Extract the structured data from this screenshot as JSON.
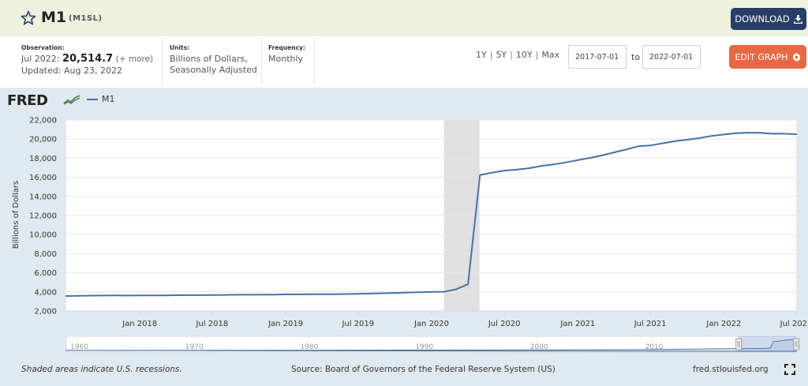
{
  "header": {
    "title": "M1",
    "series_id": "(M1SL)",
    "download_label": "DOWNLOAD"
  },
  "meta": {
    "observation_label": "Observation:",
    "observation_date": "Jul 2022:",
    "observation_value": "20,514.7",
    "observation_more": "(+ more)",
    "updated": "Updated: Aug 23, 2022",
    "units_label": "Units:",
    "units_line1": "Billions of Dollars,",
    "units_line2": "Seasonally Adjusted",
    "frequency_label": "Frequency:",
    "frequency_value": "Monthly"
  },
  "controls": {
    "ranges": [
      "1Y",
      "5Y",
      "10Y",
      "Max"
    ],
    "start_date": "2017-07-01",
    "to_label": "to",
    "end_date": "2022-07-01",
    "edit_label": "EDIT GRAPH"
  },
  "colors": {
    "series": "#4572a7",
    "download": "#283e66",
    "edit": "#e46a43",
    "recession": "#e0e0e0"
  },
  "chart_header": {
    "logo": "FRED",
    "legend_label": "M1"
  },
  "chart_data": {
    "type": "line",
    "title": "",
    "ylabel": "Billions of Dollars",
    "xlabel": "",
    "ylim": [
      2000,
      22000
    ],
    "xlim": [
      "2017-07-01",
      "2022-07-01"
    ],
    "grid": "horizontal",
    "legend_position": "top-left",
    "yticks": [
      2000,
      4000,
      6000,
      8000,
      10000,
      12000,
      14000,
      16000,
      18000,
      20000,
      22000
    ],
    "ytick_labels": [
      "2,000",
      "4,000",
      "6,000",
      "8,000",
      "10,000",
      "12,000",
      "14,000",
      "16,000",
      "18,000",
      "20,000",
      "22,000"
    ],
    "xticks": [
      {
        "date": "2018-01-01",
        "label": "Jan 2018"
      },
      {
        "date": "2018-07-01",
        "label": "Jul 2018"
      },
      {
        "date": "2019-01-01",
        "label": "Jan 2019"
      },
      {
        "date": "2019-07-01",
        "label": "Jul 2019"
      },
      {
        "date": "2020-01-01",
        "label": "Jan 2020"
      },
      {
        "date": "2020-07-01",
        "label": "Jul 2020"
      },
      {
        "date": "2021-01-01",
        "label": "Jan 2021"
      },
      {
        "date": "2021-07-01",
        "label": "Jul 2021"
      },
      {
        "date": "2022-01-01",
        "label": "Jan 2022"
      },
      {
        "date": "2022-07-01",
        "label": "Jul 2022"
      }
    ],
    "recessions": [
      {
        "start": "2020-02-01",
        "end": "2020-04-30"
      }
    ],
    "series": [
      {
        "name": "M1",
        "points": [
          [
            "2017-07-01",
            3570
          ],
          [
            "2017-08-01",
            3590
          ],
          [
            "2017-09-01",
            3610
          ],
          [
            "2017-10-01",
            3620
          ],
          [
            "2017-11-01",
            3630
          ],
          [
            "2017-12-01",
            3620
          ],
          [
            "2018-01-01",
            3640
          ],
          [
            "2018-02-01",
            3630
          ],
          [
            "2018-03-01",
            3640
          ],
          [
            "2018-04-01",
            3650
          ],
          [
            "2018-05-01",
            3660
          ],
          [
            "2018-06-01",
            3660
          ],
          [
            "2018-07-01",
            3680
          ],
          [
            "2018-08-01",
            3690
          ],
          [
            "2018-09-01",
            3700
          ],
          [
            "2018-10-01",
            3700
          ],
          [
            "2018-11-01",
            3710
          ],
          [
            "2018-12-01",
            3720
          ],
          [
            "2019-01-01",
            3740
          ],
          [
            "2019-02-01",
            3740
          ],
          [
            "2019-03-01",
            3750
          ],
          [
            "2019-04-01",
            3750
          ],
          [
            "2019-05-01",
            3760
          ],
          [
            "2019-06-01",
            3780
          ],
          [
            "2019-07-01",
            3800
          ],
          [
            "2019-08-01",
            3830
          ],
          [
            "2019-09-01",
            3860
          ],
          [
            "2019-10-01",
            3890
          ],
          [
            "2019-11-01",
            3930
          ],
          [
            "2019-12-01",
            3970
          ],
          [
            "2020-01-01",
            4000
          ],
          [
            "2020-02-01",
            4020
          ],
          [
            "2020-03-01",
            4260
          ],
          [
            "2020-04-01",
            4800
          ],
          [
            "2020-05-01",
            16230
          ],
          [
            "2020-06-01",
            16500
          ],
          [
            "2020-07-01",
            16700
          ],
          [
            "2020-08-01",
            16800
          ],
          [
            "2020-09-01",
            16950
          ],
          [
            "2020-10-01",
            17180
          ],
          [
            "2020-11-01",
            17350
          ],
          [
            "2020-12-01",
            17550
          ],
          [
            "2021-01-01",
            17800
          ],
          [
            "2021-02-01",
            18030
          ],
          [
            "2021-03-01",
            18280
          ],
          [
            "2021-04-01",
            18600
          ],
          [
            "2021-05-01",
            18900
          ],
          [
            "2021-06-01",
            19250
          ],
          [
            "2021-07-01",
            19330
          ],
          [
            "2021-08-01",
            19560
          ],
          [
            "2021-09-01",
            19780
          ],
          [
            "2021-10-01",
            19930
          ],
          [
            "2021-11-01",
            20100
          ],
          [
            "2021-12-01",
            20330
          ],
          [
            "2022-01-01",
            20480
          ],
          [
            "2022-02-01",
            20620
          ],
          [
            "2022-03-01",
            20670
          ],
          [
            "2022-04-01",
            20660
          ],
          [
            "2022-05-01",
            20560
          ],
          [
            "2022-06-01",
            20560
          ],
          [
            "2022-07-01",
            20515
          ]
        ]
      }
    ],
    "navigator": {
      "labels": [
        "1960",
        "1970",
        "1980",
        "1990",
        "2000",
        "2010"
      ],
      "range": [
        "1959-01-01",
        "2022-07-01"
      ],
      "selected": [
        "2017-07-01",
        "2022-07-01"
      ]
    }
  },
  "footer": {
    "note": "Shaded areas indicate U.S. recessions.",
    "source": "Source: Board of Governors of the Federal Reserve System (US)",
    "site": "fred.stlouisfed.org"
  }
}
